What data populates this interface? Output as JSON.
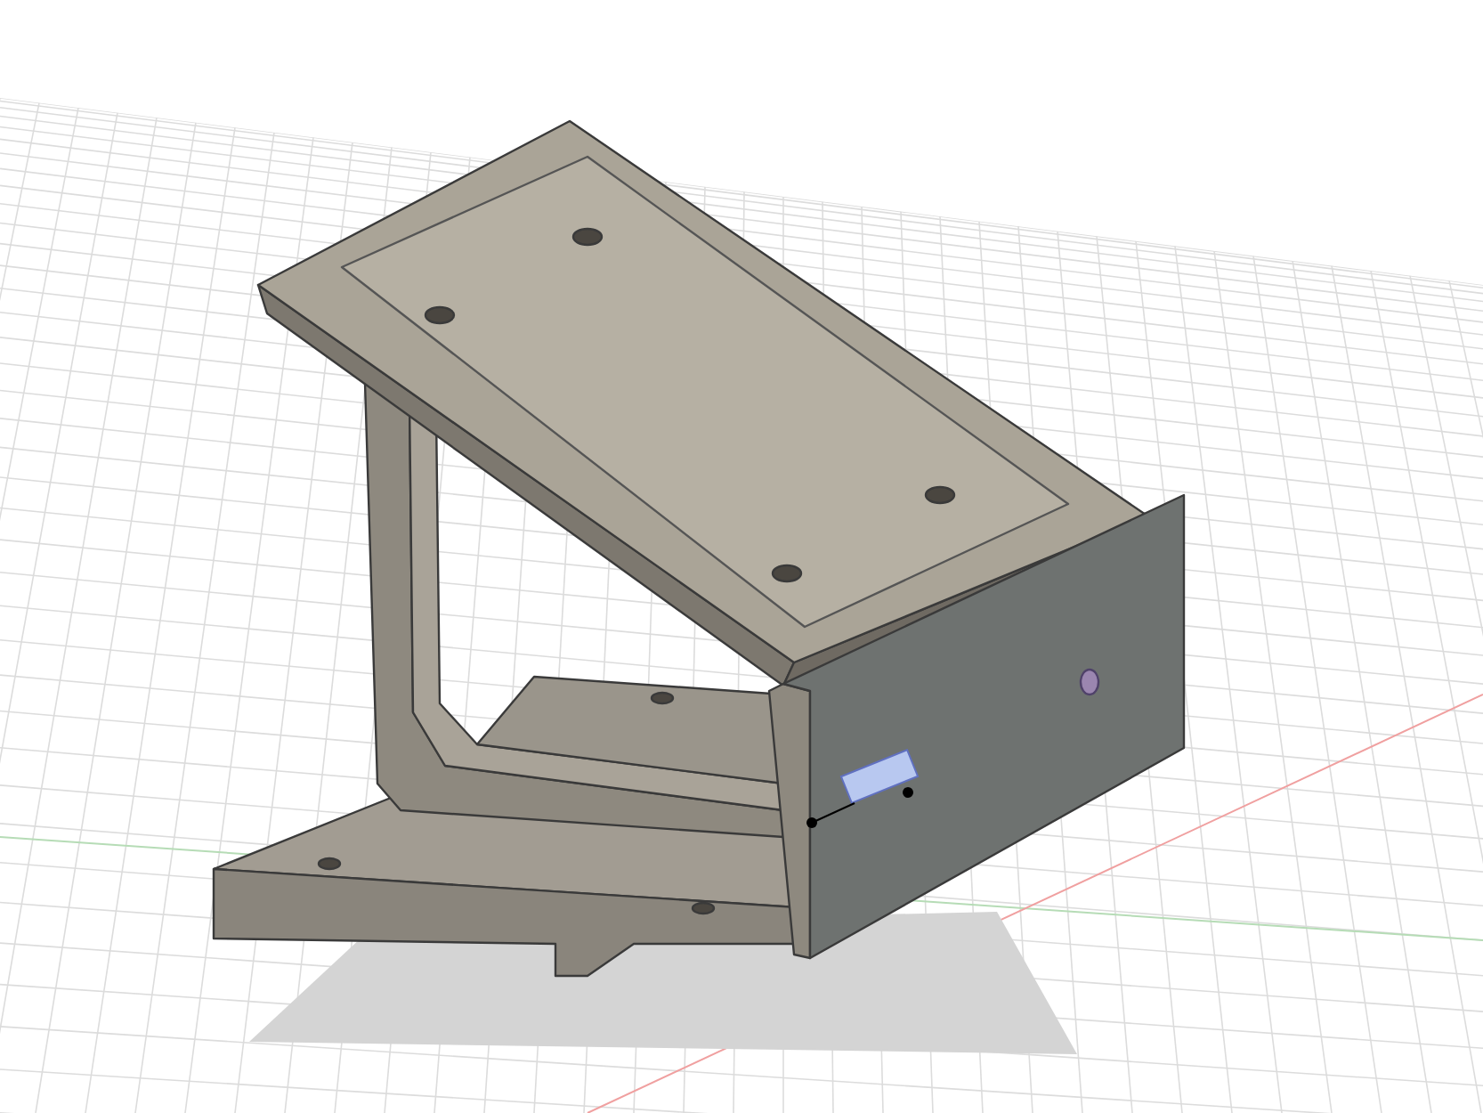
{
  "viewport": {
    "grid": true,
    "axes": true,
    "model": {
      "kind": "bracket"
    }
  }
}
